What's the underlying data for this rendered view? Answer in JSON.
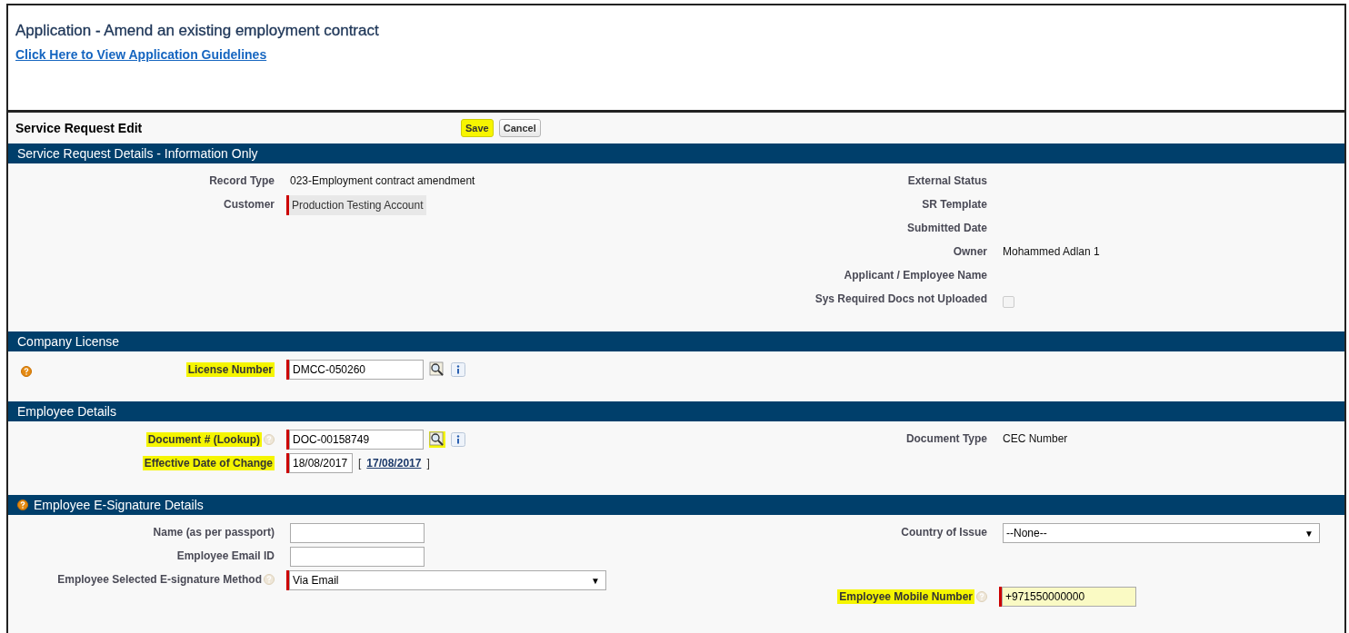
{
  "page": {
    "title": "Application - Amend an existing employment contract",
    "guidelines_link": "Click Here to View Application Guidelines"
  },
  "edit_bar": {
    "title": "Service Request Edit",
    "buttons": [
      {
        "label": "Save",
        "highlighted": true
      },
      {
        "label": "Cancel",
        "highlighted": false
      }
    ]
  },
  "sections": [
    {
      "title": "Service Request Details - Information Only",
      "header_help": false,
      "lead_help": false,
      "left": [
        {
          "kind": "text",
          "label": "Record Type",
          "value": "023-Employment contract amendment",
          "required": false,
          "highlighted": false,
          "help": false
        },
        {
          "kind": "readonly",
          "label": "Customer",
          "value": "Production Testing Account",
          "required": true,
          "highlighted": false,
          "help": false
        }
      ],
      "right": [
        {
          "kind": "text",
          "label": "External Status",
          "required": false,
          "highlighted": false,
          "help": false
        },
        {
          "kind": "text",
          "label": "SR Template",
          "required": false,
          "highlighted": false,
          "help": false
        },
        {
          "kind": "text",
          "label": "Submitted Date",
          "required": false,
          "highlighted": false,
          "help": false
        },
        {
          "kind": "text",
          "label": "Owner",
          "value": "Mohammed Adlan 1",
          "required": false,
          "highlighted": false,
          "help": false
        },
        {
          "kind": "text",
          "label": "Applicant / Employee Name",
          "required": false,
          "highlighted": false,
          "help": false
        },
        {
          "kind": "checkbox",
          "label": "Sys Required Docs not Uploaded",
          "checked": false,
          "required": false,
          "highlighted": false,
          "help": false
        }
      ]
    },
    {
      "title": "Company License",
      "header_help": false,
      "lead_help": true,
      "left": [
        {
          "kind": "lookup",
          "label": "License Number",
          "value": "DMCC-050260",
          "lookup_highlighted": false,
          "required": true,
          "highlighted": true,
          "help": false
        }
      ]
    },
    {
      "title": "Employee Details",
      "header_help": false,
      "lead_help": false,
      "left": [
        {
          "kind": "lookup",
          "label": "Document # (Lookup)",
          "value": "DOC-00158749",
          "lookup_highlighted": true,
          "required": true,
          "highlighted": true,
          "help": true
        },
        {
          "kind": "date",
          "label": "Effective Date of Change",
          "value": "18/08/2017",
          "open_bracket": "[",
          "today": "17/08/2017",
          "close_bracket": "]",
          "required": true,
          "highlighted": true,
          "help": false
        }
      ],
      "right": [
        {
          "kind": "text",
          "label": "Document Type",
          "value": "CEC Number",
          "required": false,
          "highlighted": false,
          "help": false
        }
      ]
    },
    {
      "title": "Employee E-Signature Details",
      "header_help": true,
      "lead_help": false,
      "left": [
        {
          "kind": "input",
          "label": "Name (as per passport)",
          "autofill": false,
          "required": false,
          "highlighted": false,
          "help": false
        },
        {
          "kind": "input",
          "label": "Employee Email ID",
          "autofill": false,
          "required": false,
          "highlighted": false,
          "help": false
        },
        {
          "kind": "select",
          "label": "Employee Selected E-signature Method",
          "value": "Via Email",
          "caret": "▼",
          "required": true,
          "highlighted": false,
          "help": true
        }
      ],
      "right": [
        {
          "kind": "select",
          "label": "Country of Issue",
          "value": "--None--",
          "caret": "▼",
          "required": false,
          "highlighted": false,
          "help": false
        },
        {
          "kind": "spacer"
        },
        {
          "kind": "input",
          "label": "Employee Mobile Number",
          "value": "+971550000000",
          "autofill": true,
          "required": true,
          "highlighted": true,
          "help": true
        }
      ]
    }
  ]
}
